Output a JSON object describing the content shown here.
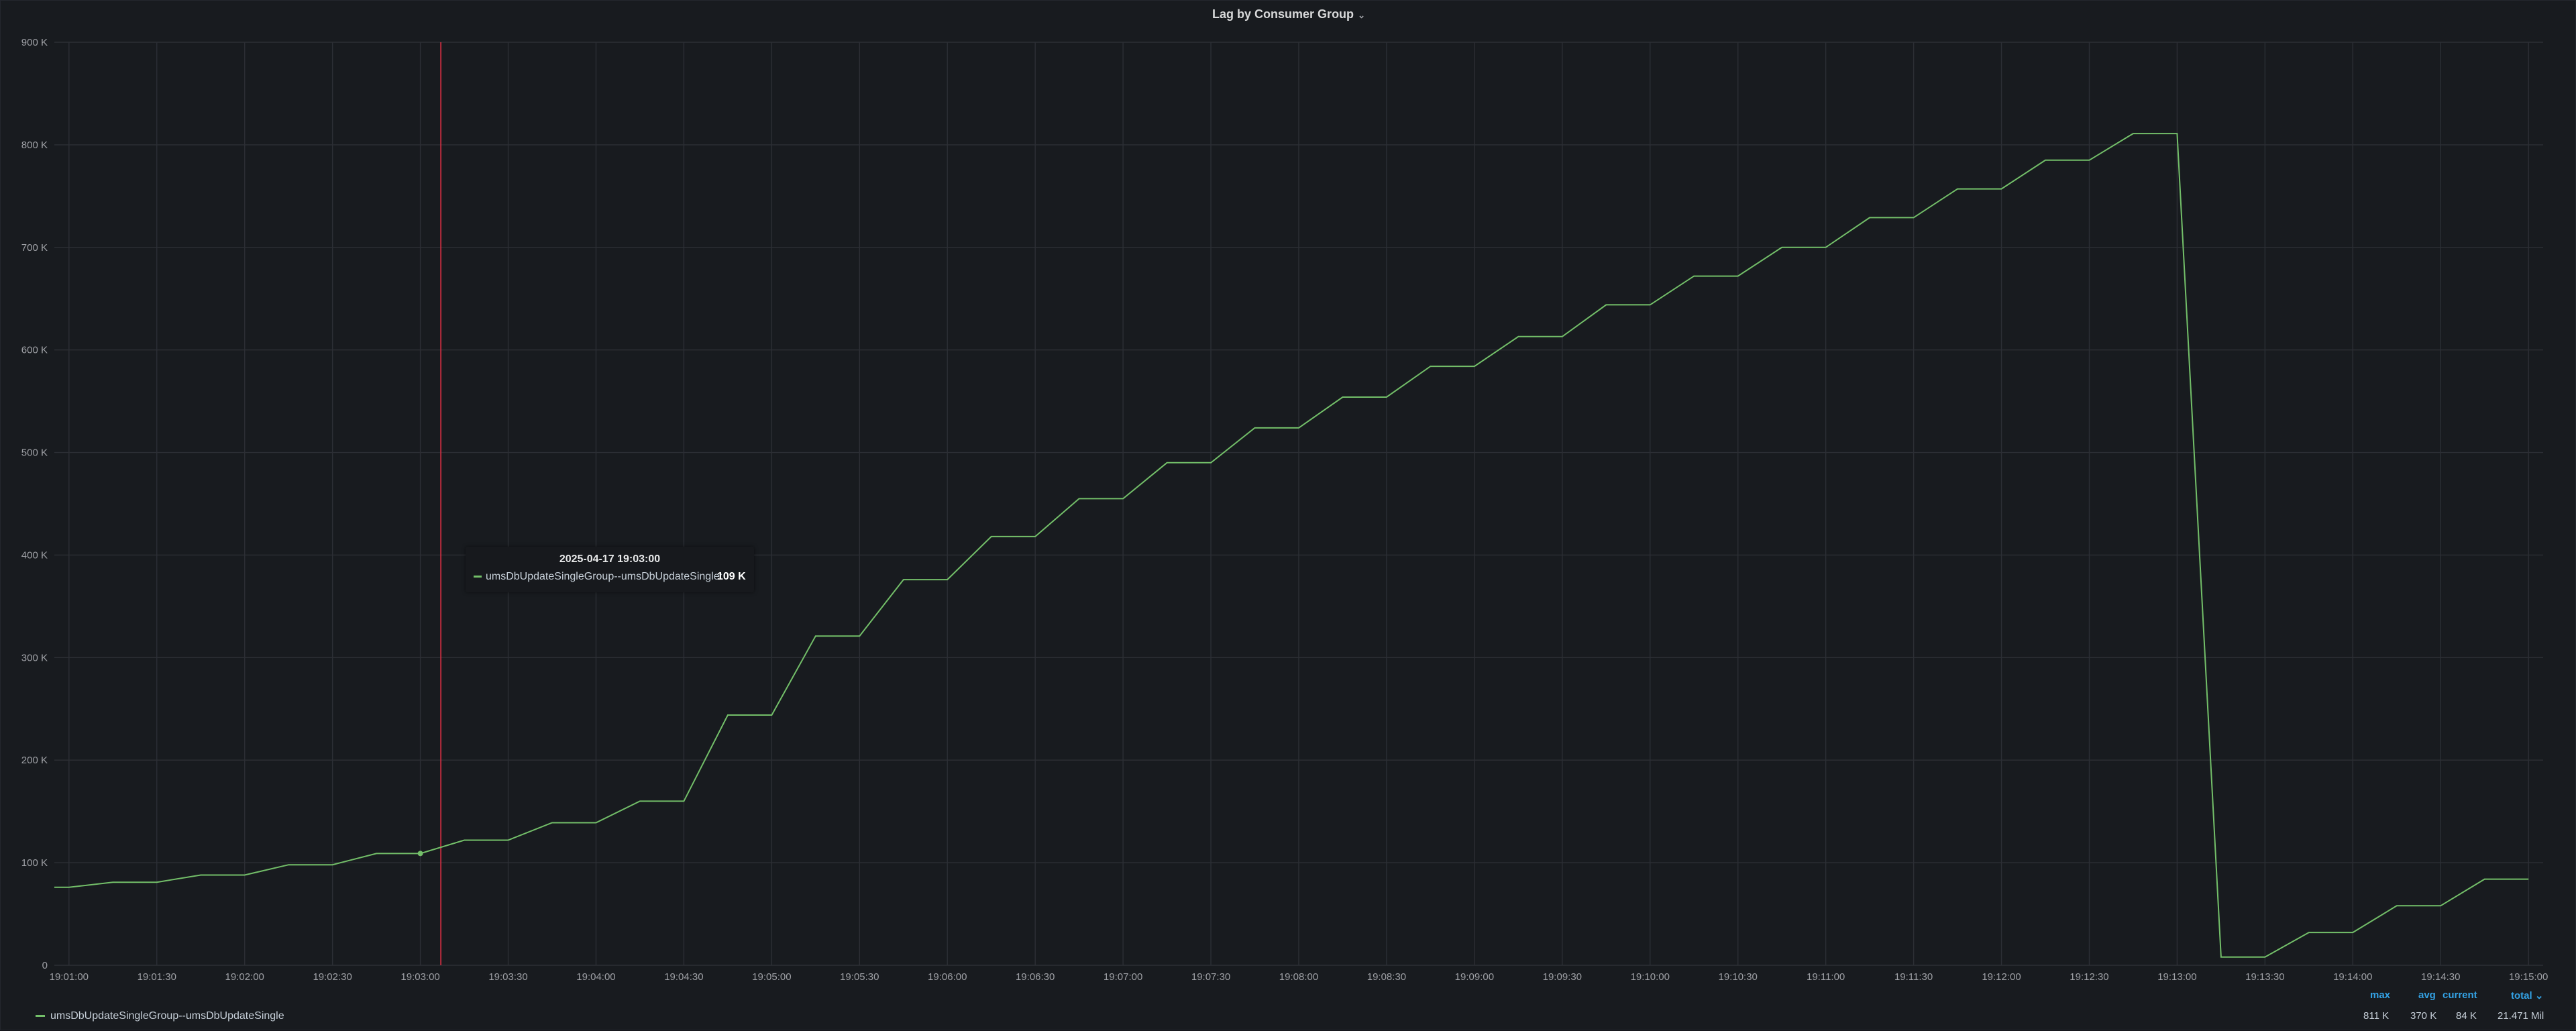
{
  "panel": {
    "title": "Lag by Consumer Group",
    "chevron": "⌄"
  },
  "colors": {
    "series": "#73bf69",
    "cursor": "#e02f44",
    "legend_header": "#33a2e5"
  },
  "tooltip": {
    "time": "2025-04-17 19:03:00",
    "series": "umsDbUpdateSingleGroup--umsDbUpdateSingle:",
    "value": "109 K"
  },
  "legend": {
    "series_name": "umsDbUpdateSingleGroup--umsDbUpdateSingle",
    "headers": {
      "max": "max",
      "avg": "avg",
      "current": "current",
      "total": "total ⌄"
    },
    "values": {
      "max": "811 K",
      "avg": "370 K",
      "current": "84 K",
      "total": "21.471 Mil"
    }
  },
  "chart_data": {
    "type": "line",
    "x_start": "19:00:55",
    "x_end": "19:15:05",
    "ylim": [
      0,
      900000
    ],
    "y_ticks": [
      "0",
      "100 K",
      "200 K",
      "300 K",
      "400 K",
      "500 K",
      "600 K",
      "700 K",
      "800 K",
      "900 K"
    ],
    "x_ticks": [
      "19:01:00",
      "19:01:30",
      "19:02:00",
      "19:02:30",
      "19:03:00",
      "19:03:30",
      "19:04:00",
      "19:04:30",
      "19:05:00",
      "19:05:30",
      "19:06:00",
      "19:06:30",
      "19:07:00",
      "19:07:30",
      "19:08:00",
      "19:08:30",
      "19:09:00",
      "19:09:30",
      "19:10:00",
      "19:10:30",
      "19:11:00",
      "19:11:30",
      "19:12:00",
      "19:12:30",
      "19:13:00",
      "19:13:30",
      "19:14:00",
      "19:14:30",
      "19:15:00"
    ],
    "cursor_time": "19:03:07",
    "hover_point": {
      "time": "19:03:00",
      "value": 109000
    },
    "series": [
      {
        "name": "umsDbUpdateSingleGroup--umsDbUpdateSingle",
        "points": [
          [
            "19:00:55",
            76000
          ],
          [
            "19:01:00",
            76000
          ],
          [
            "19:01:15",
            81000
          ],
          [
            "19:01:30",
            81000
          ],
          [
            "19:01:45",
            88000
          ],
          [
            "19:02:00",
            88000
          ],
          [
            "19:02:15",
            98000
          ],
          [
            "19:02:30",
            98000
          ],
          [
            "19:02:45",
            109000
          ],
          [
            "19:03:00",
            109000
          ],
          [
            "19:03:15",
            122000
          ],
          [
            "19:03:30",
            122000
          ],
          [
            "19:03:45",
            139000
          ],
          [
            "19:04:00",
            139000
          ],
          [
            "19:04:15",
            160000
          ],
          [
            "19:04:30",
            160000
          ],
          [
            "19:04:45",
            244000
          ],
          [
            "19:05:00",
            244000
          ],
          [
            "19:05:15",
            321000
          ],
          [
            "19:05:30",
            321000
          ],
          [
            "19:05:45",
            376000
          ],
          [
            "19:06:00",
            376000
          ],
          [
            "19:06:15",
            418000
          ],
          [
            "19:06:30",
            418000
          ],
          [
            "19:06:45",
            455000
          ],
          [
            "19:07:00",
            455000
          ],
          [
            "19:07:15",
            490000
          ],
          [
            "19:07:30",
            490000
          ],
          [
            "19:07:45",
            524000
          ],
          [
            "19:08:00",
            524000
          ],
          [
            "19:08:15",
            554000
          ],
          [
            "19:08:30",
            554000
          ],
          [
            "19:08:45",
            584000
          ],
          [
            "19:09:00",
            584000
          ],
          [
            "19:09:15",
            613000
          ],
          [
            "19:09:30",
            613000
          ],
          [
            "19:09:45",
            644000
          ],
          [
            "19:10:00",
            644000
          ],
          [
            "19:10:15",
            672000
          ],
          [
            "19:10:30",
            672000
          ],
          [
            "19:10:45",
            700000
          ],
          [
            "19:11:00",
            700000
          ],
          [
            "19:11:15",
            729000
          ],
          [
            "19:11:30",
            729000
          ],
          [
            "19:11:45",
            757000
          ],
          [
            "19:12:00",
            757000
          ],
          [
            "19:12:15",
            785000
          ],
          [
            "19:12:30",
            785000
          ],
          [
            "19:12:45",
            811000
          ],
          [
            "19:13:00",
            811000
          ],
          [
            "19:13:15",
            8000
          ],
          [
            "19:13:30",
            8000
          ],
          [
            "19:13:45",
            32000
          ],
          [
            "19:14:00",
            32000
          ],
          [
            "19:14:15",
            58000
          ],
          [
            "19:14:30",
            58000
          ],
          [
            "19:14:45",
            84000
          ],
          [
            "19:15:00",
            84000
          ]
        ]
      }
    ]
  }
}
